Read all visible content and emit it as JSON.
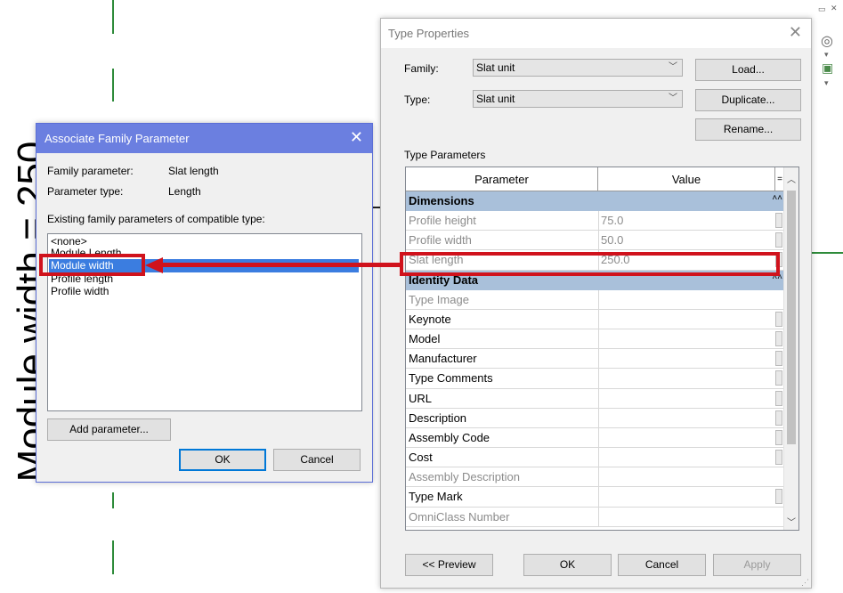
{
  "annotation": {
    "text": "Module width = 250"
  },
  "toolbar_icons": [
    "pin-icon",
    "close-icon",
    "zoom-icon",
    "navigation-icon"
  ],
  "type_properties": {
    "title": "Type Properties",
    "family_label": "Family:",
    "family_value": "Slat unit",
    "type_label": "Type:",
    "type_value": "Slat unit",
    "load_button": "Load...",
    "duplicate_button": "Duplicate...",
    "rename_button": "Rename...",
    "section_label": "Type Parameters",
    "columns": {
      "parameter": "Parameter",
      "value": "Value"
    },
    "groups": {
      "dimensions": {
        "title": "Dimensions",
        "rows": [
          {
            "param": "Profile height",
            "value": "75.0"
          },
          {
            "param": "Profile width",
            "value": "50.0"
          },
          {
            "param": "Slat length",
            "value": "250.0"
          }
        ]
      },
      "identity": {
        "title": "Identity Data",
        "rows": [
          {
            "param": "Type Image",
            "value": ""
          },
          {
            "param": "Keynote",
            "value": ""
          },
          {
            "param": "Model",
            "value": ""
          },
          {
            "param": "Manufacturer",
            "value": ""
          },
          {
            "param": "Type Comments",
            "value": ""
          },
          {
            "param": "URL",
            "value": ""
          },
          {
            "param": "Description",
            "value": ""
          },
          {
            "param": "Assembly Code",
            "value": ""
          },
          {
            "param": "Cost",
            "value": ""
          },
          {
            "param": "Assembly Description",
            "value": ""
          },
          {
            "param": "Type Mark",
            "value": ""
          },
          {
            "param": "OmniClass Number",
            "value": ""
          }
        ]
      }
    },
    "preview_button": "<< Preview",
    "ok_button": "OK",
    "cancel_button": "Cancel",
    "apply_button": "Apply"
  },
  "associate_dialog": {
    "title": "Associate Family Parameter",
    "family_parameter_label": "Family parameter:",
    "family_parameter_value": "Slat length",
    "parameter_type_label": "Parameter type:",
    "parameter_type_value": "Length",
    "existing_label": "Existing family parameters of compatible type:",
    "options": [
      "<none>",
      "Module Length",
      "Module width",
      "Profile length",
      "Profile width"
    ],
    "selected": "Module width",
    "add_parameter_button": "Add parameter...",
    "ok_button": "OK",
    "cancel_button": "Cancel"
  }
}
